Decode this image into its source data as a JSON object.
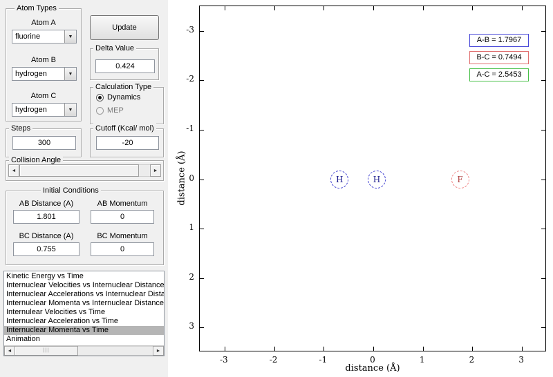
{
  "window": {
    "bg_color": "#f0f0f0",
    "figure_bg": "#ffffff"
  },
  "atom_types": {
    "title": "Atom Types",
    "atom_a_label": "Atom A",
    "atom_a_value": "fluorine",
    "atom_b_label": "Atom B",
    "atom_b_value": "hydrogen",
    "atom_c_label": "Atom C",
    "atom_c_value": "hydrogen"
  },
  "update_button_label": "Update",
  "delta": {
    "title": "Delta Value",
    "value": "0.424"
  },
  "calculation_type": {
    "title": "Calculation Type",
    "options": [
      {
        "label": "Dynamics",
        "selected": true
      },
      {
        "label": "MEP",
        "selected": false
      }
    ]
  },
  "steps": {
    "title": "Steps",
    "value": "300"
  },
  "cutoff": {
    "title": "Cutoff (Kcal/ mol)",
    "value": "-20"
  },
  "collision_angle": {
    "title": "Collision Angle"
  },
  "initial_conditions": {
    "title": "Initial Conditions",
    "ab_distance_label": "AB Distance (A)",
    "ab_distance_value": "1.801",
    "ab_momentum_label": "AB Momentum",
    "ab_momentum_value": "0",
    "bc_distance_label": "BC Distance (A)",
    "bc_distance_value": "0.755",
    "bc_momentum_label": "BC Momentum",
    "bc_momentum_value": "0"
  },
  "plot_list": {
    "items": [
      "Kinetic Energy vs Time",
      "Internuclear Velocities vs Internuclear Distance",
      "Internuclear Accelerations vs Internuclear Distance",
      "Internuclear Momenta vs Internuclear Distance",
      "Internulear Velocities vs Time",
      "Internuclear Acceleration vs Time",
      "Internuclear Momenta vs Time",
      "Animation"
    ],
    "selected_index": 6,
    "selected_item": "Internuclear Momenta vs Time"
  },
  "chart_data": {
    "type": "scatter",
    "title": "",
    "xlabel": "distance (Å)",
    "ylabel": "distance (Å)",
    "xlim": [
      -3.5,
      3.5
    ],
    "ylim": [
      -3.5,
      3.5
    ],
    "y_axis_inverted": true,
    "grid": false,
    "xticks": [
      -3,
      -2,
      -1,
      0,
      1,
      2,
      3
    ],
    "yticks": [
      -3,
      -2,
      -1,
      0,
      1,
      2,
      3
    ],
    "atoms": [
      {
        "label": "H",
        "x": -0.68,
        "y": 0,
        "circle_color": "#3c3cd0",
        "label_color": "#1a1a8c"
      },
      {
        "label": "H",
        "x": 0.07,
        "y": 0,
        "circle_color": "#3c3cd0",
        "label_color": "#1a1a8c"
      },
      {
        "label": "F",
        "x": 1.75,
        "y": 0,
        "circle_color": "#f08080",
        "label_color": "#b04040"
      }
    ],
    "legend_position": "top-right",
    "legend": [
      {
        "label": "A-B = 1.7967",
        "color": "#4848d8"
      },
      {
        "label": "B-C = 0.7494",
        "color": "#e07070"
      },
      {
        "label": "A-C = 2.5453",
        "color": "#48c048"
      }
    ]
  }
}
